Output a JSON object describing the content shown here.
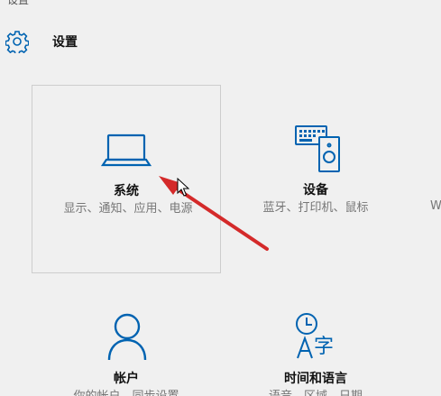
{
  "window": {
    "title": "设置"
  },
  "header": {
    "title": "设置",
    "icon": "gear-icon"
  },
  "accent_color": "#0063b1",
  "tiles": [
    {
      "name": "系统",
      "desc": "显示、通知、应用、电源",
      "icon": "laptop-icon"
    },
    {
      "name": "设备",
      "desc": "蓝牙、打印机、鼠标",
      "icon": "keyboard-speaker-icon"
    },
    {
      "name": "帐户",
      "desc": "你的帐户、同步设置",
      "icon": "person-icon"
    },
    {
      "name": "时间和语言",
      "desc": "语音、区域、日期",
      "icon": "clock-language-icon"
    }
  ],
  "partial_tile_text": "W",
  "annotation": {
    "color": "#d42a2a",
    "icon": "red-arrow-icon"
  }
}
